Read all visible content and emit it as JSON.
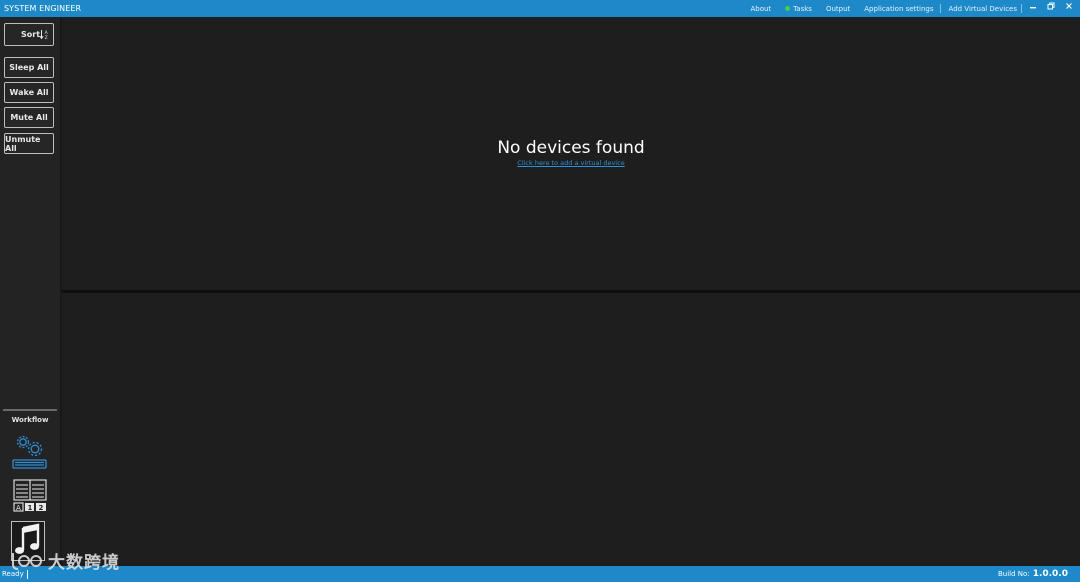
{
  "app": {
    "title": "SYSTEM ENGINEER"
  },
  "title_menu": {
    "about": "About",
    "tasks": "Tasks",
    "output": "Output",
    "settings": "Application settings",
    "add_virtual": "Add Virtual Devices",
    "tasks_status_color": "#3fd34a"
  },
  "window_controls": {
    "minimize": "‗",
    "restore": "⧉",
    "close": "✕"
  },
  "sidebar": {
    "sort_label": "Sort",
    "sort_icon": "↓⇵",
    "buttons": [
      "Sleep All",
      "Wake All",
      "Mute All",
      "Unmute All"
    ],
    "workflow_label": "Workflow",
    "workflow_icons": [
      "gears-keyboard-icon",
      "layout-numbered-icon",
      "music-note-icon"
    ]
  },
  "main": {
    "empty_title": "No devices found",
    "empty_link": "Click here to add a virtual device"
  },
  "status": {
    "text": "Ready",
    "build_label": "Build No:",
    "build_version": "1.0.0.0"
  },
  "watermark": {
    "text": "大数跨境"
  },
  "colors": {
    "accent": "#1e89c8",
    "background": "#1e1e1e",
    "link": "#2e8fd6"
  }
}
